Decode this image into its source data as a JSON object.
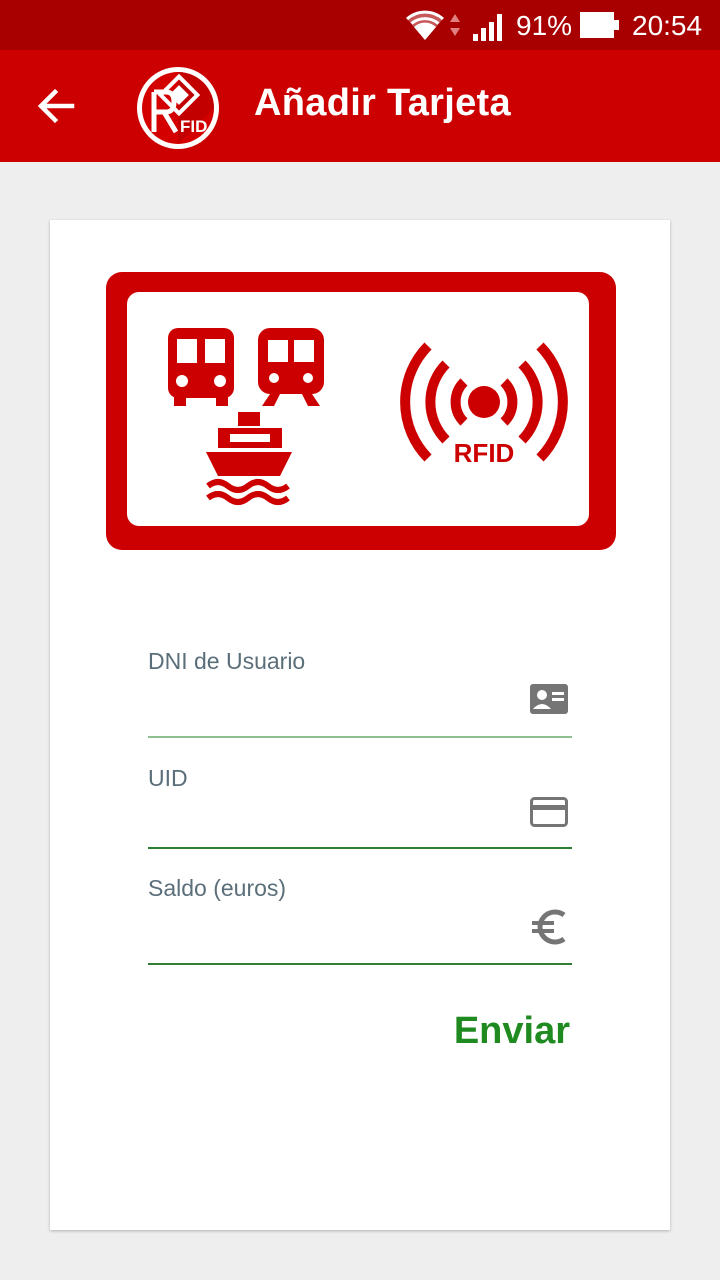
{
  "status_bar": {
    "battery_percent": "91%",
    "time": "20:54"
  },
  "app_bar": {
    "title": "Añadir Tarjeta",
    "logo_text": "FID"
  },
  "banner": {
    "rfid_label": "RFID"
  },
  "form": {
    "fields": [
      {
        "label": "DNI de Usuario",
        "value": "",
        "icon": "id-card-icon"
      },
      {
        "label": "UID",
        "value": "",
        "icon": "credit-card-icon"
      },
      {
        "label": "Saldo (euros)",
        "value": "",
        "icon": "euro-icon"
      }
    ],
    "submit_label": "Enviar"
  },
  "colors": {
    "status_bar": "#a80000",
    "app_bar": "#cc0000",
    "brand_red": "#cc0000",
    "button_green": "#1f8a1f",
    "label_gray": "#5b6f7a"
  }
}
